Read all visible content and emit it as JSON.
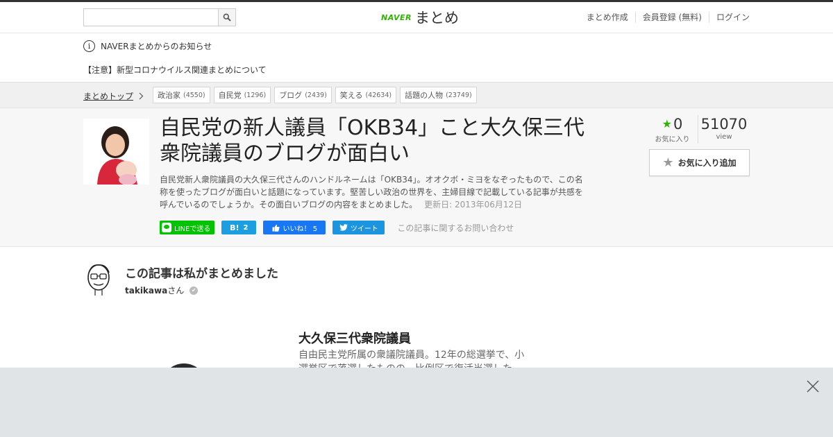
{
  "header": {
    "search_placeholder": "",
    "logo_brand": "NAVER",
    "logo_name": "まとめ",
    "nav": [
      "まとめ作成",
      "会員登録 (無料)",
      "ログイン"
    ]
  },
  "notice": {
    "info": "NAVERまとめからのお知らせ",
    "link": "【注意】新型コロナウイルス関連まとめについて"
  },
  "breadcrumb": {
    "top_label": "まとめトップ",
    "tags": [
      {
        "label": "政治家",
        "count": "(4550)"
      },
      {
        "label": "自民党",
        "count": "(1296)"
      },
      {
        "label": "ブログ",
        "count": "(2439)"
      },
      {
        "label": "笑える",
        "count": "(42634)"
      },
      {
        "label": "話題の人物",
        "count": "(23749)"
      }
    ]
  },
  "article": {
    "title": "自民党の新人議員「OKB34」こと大久保三代衆院議員のブログが面白い",
    "description": "自民党新人衆院議員の大久保三代さんのハンドルネームは「OKB34」。オオクボ・ミヨをなぞったもので、この名称を使ったブログが面白いと話題になっています。堅苦しい政治の世界を、主婦目線で記載している記事が共感を呼んでいるのでしょうか。その面白いブログの内容をまとめました。",
    "updated": "更新日: 2013年06月12日",
    "favorites": "0",
    "favorites_label": "お気に入り",
    "views": "51070",
    "views_label": "view",
    "fav_button": "お気に入り追加",
    "share": {
      "line": "LINEで送る",
      "hatena": "2",
      "facebook": "いいね！ 5",
      "twitter": "ツイート",
      "inquiry": "この記事に関するお問い合わせ"
    }
  },
  "author": {
    "heading": "この記事は私がまとめました",
    "name": "takikawa",
    "suffix": "さん"
  },
  "item": {
    "title": "大久保三代衆院議員",
    "description": "自由民主党所属の衆議院議員。12年の総選挙で、小選挙区で落選したものの、比例区で復活当選した。"
  }
}
